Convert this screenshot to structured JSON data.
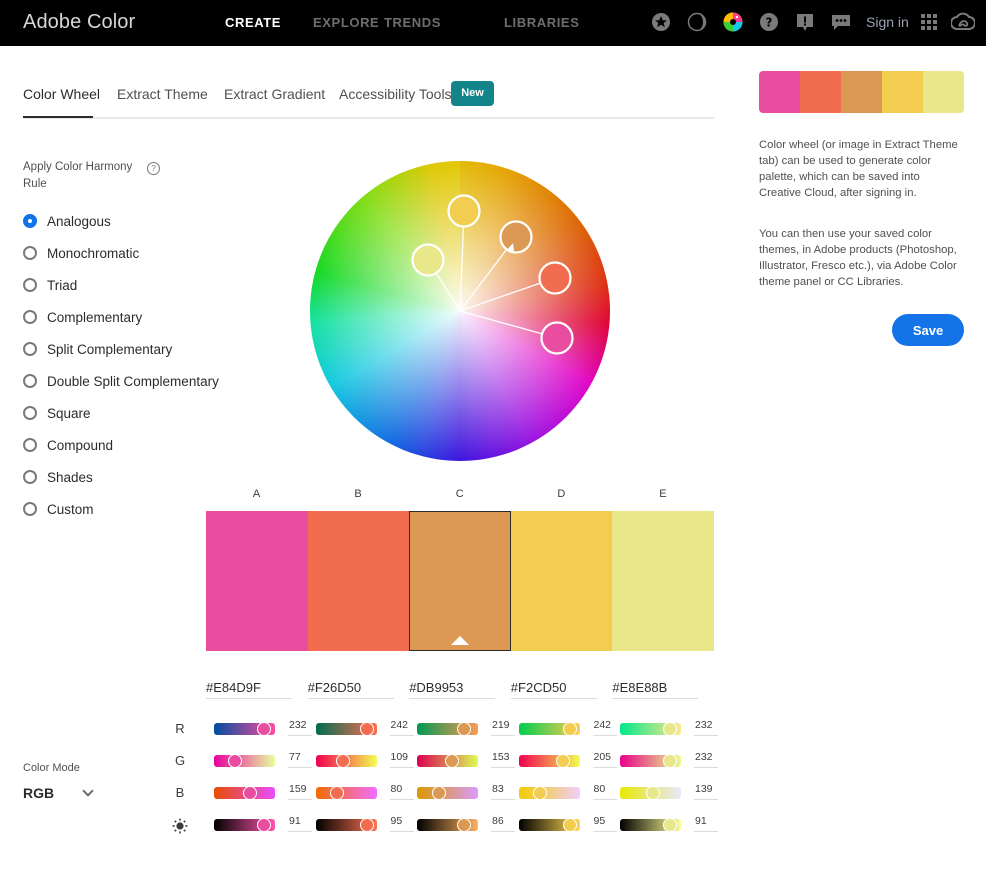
{
  "header": {
    "brand": "Adobe Color",
    "nav": [
      {
        "label": "CREATE",
        "active": true
      },
      {
        "label": "EXPLORE",
        "active": false
      },
      {
        "label": "TRENDS",
        "active": false
      },
      {
        "label": "LIBRARIES",
        "active": false
      }
    ],
    "icons": [
      "star-badge-icon",
      "moon-phase-icon",
      "color-wheel-icon",
      "help-icon",
      "feedback-alert-icon",
      "chat-icon"
    ],
    "sign_in": "Sign in",
    "apps_icon": "apps-grid-icon",
    "cc_icon": "creative-cloud-icon"
  },
  "tabs": [
    {
      "label": "Color Wheel",
      "active": true
    },
    {
      "label": "Extract Theme",
      "active": false
    },
    {
      "label": "Extract Gradient",
      "active": false
    },
    {
      "label": "Accessibility Tools",
      "active": false
    }
  ],
  "tab_badge": "New",
  "harmony": {
    "title": "Apply Color Harmony Rule",
    "help": "?",
    "rules": [
      {
        "label": "Analogous",
        "checked": true
      },
      {
        "label": "Monochromatic",
        "checked": false
      },
      {
        "label": "Triad",
        "checked": false
      },
      {
        "label": "Complementary",
        "checked": false
      },
      {
        "label": "Split Complementary",
        "checked": false
      },
      {
        "label": "Double Split Complementary",
        "checked": false
      },
      {
        "label": "Square",
        "checked": false
      },
      {
        "label": "Compound",
        "checked": false
      },
      {
        "label": "Shades",
        "checked": false
      },
      {
        "label": "Custom",
        "checked": false
      }
    ]
  },
  "swatches": [
    {
      "label": "A",
      "hex": "#E84D9F",
      "r": 232,
      "g": 77,
      "b": 159,
      "brightness": 91,
      "selected": false
    },
    {
      "label": "B",
      "hex": "#F26D50",
      "r": 242,
      "g": 109,
      "b": 80,
      "brightness": 95,
      "selected": false
    },
    {
      "label": "C",
      "hex": "#DB9953",
      "r": 219,
      "g": 153,
      "b": 83,
      "brightness": 86,
      "selected": true
    },
    {
      "label": "D",
      "hex": "#F2CD50",
      "r": 242,
      "g": 205,
      "b": 80,
      "brightness": 95,
      "selected": false
    },
    {
      "label": "E",
      "hex": "#E8E88B",
      "r": 232,
      "g": 232,
      "b": 139,
      "brightness": 91,
      "selected": false
    }
  ],
  "channels": [
    {
      "label": "R"
    },
    {
      "label": "G"
    },
    {
      "label": "B"
    },
    {
      "label": "",
      "icon": "brightness-icon"
    }
  ],
  "color_mode": {
    "label": "Color Mode",
    "value": "RGB"
  },
  "side_panel": {
    "info_1": "Color wheel (or image in Extract Theme tab) can be used to generate color palette, which can be saved into Creative Cloud, after signing in.",
    "info_2": "You can then use your saved color themes, in Adobe products (Photoshop, Illustrator, Fresco etc.), via Adobe Color theme panel or CC Libraries.",
    "save_label": "Save"
  }
}
